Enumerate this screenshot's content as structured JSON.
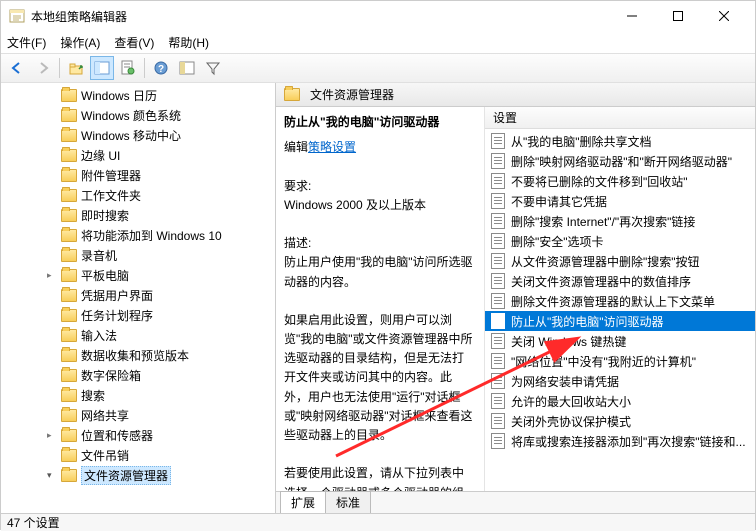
{
  "window": {
    "title": "本地组策略编辑器"
  },
  "menu": {
    "file": "文件(F)",
    "action": "操作(A)",
    "view": "查看(V)",
    "help": "帮助(H)"
  },
  "tree": {
    "items": [
      {
        "label": "Windows 日历",
        "expandable": false
      },
      {
        "label": "Windows 颜色系统",
        "expandable": false
      },
      {
        "label": "Windows 移动中心",
        "expandable": false
      },
      {
        "label": "边缘 UI",
        "expandable": false
      },
      {
        "label": "附件管理器",
        "expandable": false
      },
      {
        "label": "工作文件夹",
        "expandable": false
      },
      {
        "label": "即时搜索",
        "expandable": false
      },
      {
        "label": "将功能添加到 Windows 10",
        "expandable": false
      },
      {
        "label": "录音机",
        "expandable": false
      },
      {
        "label": "平板电脑",
        "expandable": true
      },
      {
        "label": "凭据用户界面",
        "expandable": false
      },
      {
        "label": "任务计划程序",
        "expandable": false
      },
      {
        "label": "输入法",
        "expandable": false
      },
      {
        "label": "数据收集和预览版本",
        "expandable": false
      },
      {
        "label": "数字保险箱",
        "expandable": false
      },
      {
        "label": "搜索",
        "expandable": false
      },
      {
        "label": "网络共享",
        "expandable": false
      },
      {
        "label": "位置和传感器",
        "expandable": true
      },
      {
        "label": "文件吊销",
        "expandable": false
      },
      {
        "label": "文件资源管理器",
        "expandable": true,
        "expanded": true,
        "selected": true
      }
    ]
  },
  "header": {
    "title": "文件资源管理器"
  },
  "description": {
    "title": "防止从\"我的电脑\"访问驱动器",
    "edit_label": "编辑",
    "policy_link": "策略设置",
    "req_label": "要求:",
    "req_text": "Windows 2000 及以上版本",
    "desc_label": "描述:",
    "desc_body1": "防止用户使用\"我的电脑\"访问所选驱动器的内容。",
    "desc_body2": "如果启用此设置，则用户可以浏览\"我的电脑\"或文件资源管理器中所选驱动器的目录结构，但是无法打开文件夹或访问其中的内容。此外，用户也无法使用\"运行\"对话框或\"映射网络驱动器\"对话框来查看这些驱动器上的目录。",
    "desc_body3": "若要使用此设置，请从下拉列表中选择一个驱动器或多个驱动器的组合。"
  },
  "settings": {
    "column_label": "设置",
    "items": [
      {
        "label": "从\"我的电脑\"删除共享文档"
      },
      {
        "label": "删除\"映射网络驱动器\"和\"断开网络驱动器\""
      },
      {
        "label": "不要将已删除的文件移到\"回收站\""
      },
      {
        "label": "不要申请其它凭据"
      },
      {
        "label": "删除\"搜索 Internet\"/\"再次搜索\"链接"
      },
      {
        "label": "删除\"安全\"选项卡"
      },
      {
        "label": "从文件资源管理器中删除\"搜索\"按钮"
      },
      {
        "label": "关闭文件资源管理器中的数值排序"
      },
      {
        "label": "删除文件资源管理器的默认上下文菜单"
      },
      {
        "label": "防止从\"我的电脑\"访问驱动器",
        "selected": true
      },
      {
        "label": "关闭 Windows 键热键"
      },
      {
        "label": "\"网络位置\"中没有\"我附近的计算机\""
      },
      {
        "label": "为网络安装申请凭据"
      },
      {
        "label": "允许的最大回收站大小"
      },
      {
        "label": "关闭外壳协议保护模式"
      },
      {
        "label": "将库或搜索连接器添加到\"再次搜索\"链接和..."
      }
    ]
  },
  "tabs": {
    "extended": "扩展",
    "standard": "标准"
  },
  "statusbar": {
    "text": "47 个设置"
  }
}
